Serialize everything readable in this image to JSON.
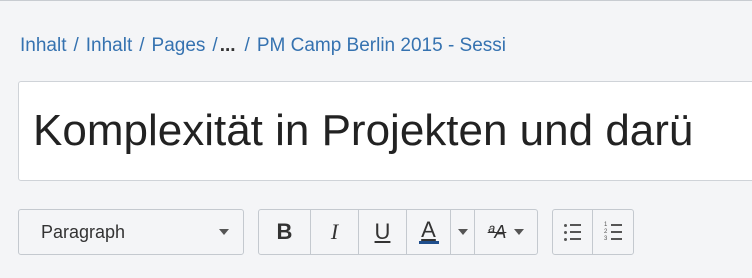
{
  "breadcrumb": {
    "items": [
      "Inhalt",
      "Inhalt",
      "Pages"
    ],
    "ellipsis": "...",
    "current": "PM Camp Berlin 2015 - Sessi",
    "separator": "/"
  },
  "title": {
    "value": "Komplexität in Projekten und darü"
  },
  "toolbar": {
    "paragraph_label": "Paragraph",
    "bold_label": "B",
    "italic_label": "I",
    "underline_label": "U",
    "text_color_label": "A",
    "text_color": "#1f4e8c",
    "format_label": "ªA",
    "bullet_list_icon": "bullet-list-icon",
    "numbered_list_icon": "numbered-list-icon"
  }
}
